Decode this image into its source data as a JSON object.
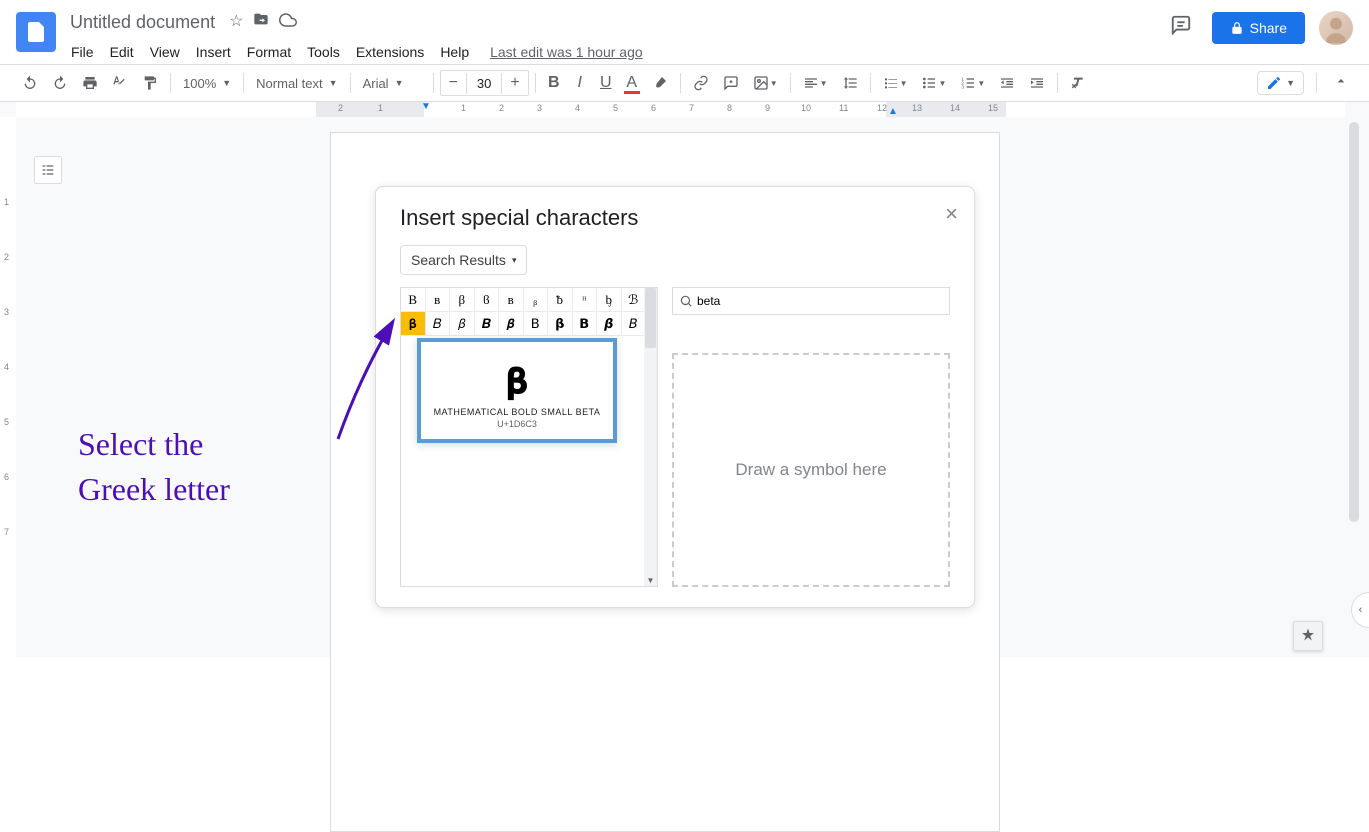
{
  "doc": {
    "title": "Untitled document"
  },
  "menus": [
    "File",
    "Edit",
    "View",
    "Insert",
    "Format",
    "Tools",
    "Extensions",
    "Help"
  ],
  "last_edit": "Last edit was 1 hour ago",
  "share_label": "Share",
  "toolbar": {
    "zoom": "100%",
    "style": "Normal text",
    "font": "Arial",
    "size": "30"
  },
  "ruler_h": [
    "2",
    "1",
    "",
    "1",
    "2",
    "3",
    "4",
    "5",
    "6",
    "7",
    "8",
    "9",
    "10",
    "11",
    "12",
    "13",
    "14",
    "15"
  ],
  "ruler_v": [
    "",
    "1",
    "2",
    "3",
    "4",
    "5",
    "6",
    "7"
  ],
  "dialog": {
    "title": "Insert special characters",
    "filter": "Search Results",
    "search_value": "beta",
    "draw_placeholder": "Draw a symbol here",
    "chars_row1": [
      "B",
      "ʙ",
      "β",
      "ϐ",
      "в",
      "ᵦ",
      "ᵬ",
      "ᵸ",
      "ᶀ",
      "ℬ"
    ],
    "chars_row2": [
      "𝛃",
      "𝐵",
      "𝛽",
      "𝑩",
      "𝜷",
      "𝖡",
      "𝝱",
      "𝗕",
      "𝞫",
      "𝘉"
    ],
    "tooltip": {
      "glyph": "𝛃",
      "name": "MATHEMATICAL BOLD SMALL BETA",
      "code": "U+1D6C3"
    }
  },
  "annotation": {
    "line1": "Select the",
    "line2": "Greek letter"
  }
}
